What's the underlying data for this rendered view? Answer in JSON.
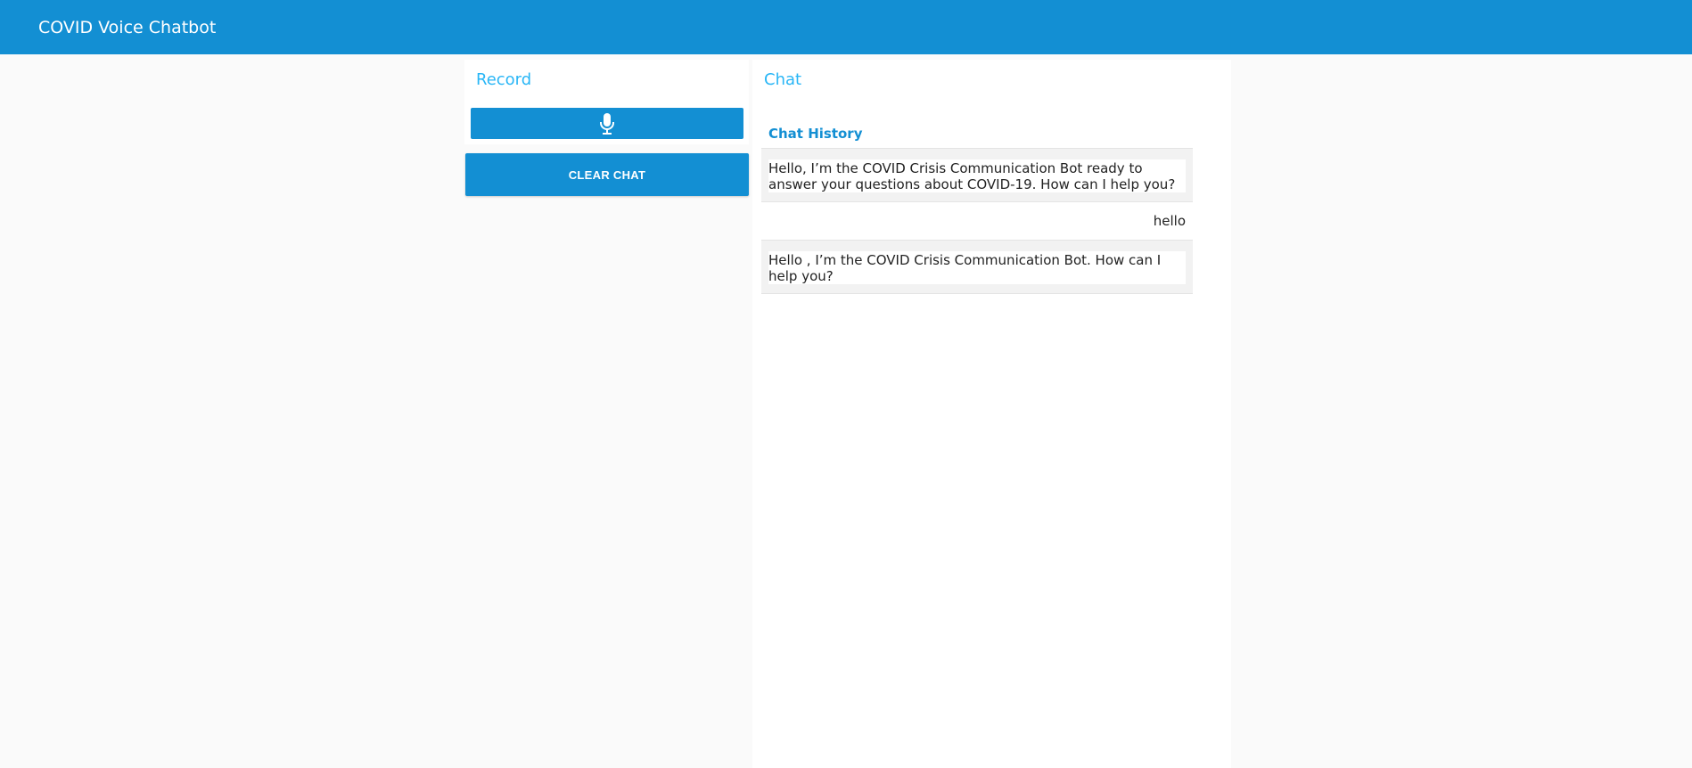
{
  "app": {
    "title": "COVID Voice Chatbot",
    "accent_color": "#138fd3",
    "heading_color": "#29b6f6"
  },
  "record": {
    "heading": "Record",
    "mic_button_icon": "microphone-icon",
    "clear_label": "CLEAR CHAT"
  },
  "chat": {
    "heading": "Chat",
    "history_title": "Chat History",
    "messages": [
      {
        "sender": "bot",
        "text": "Hello, I’m the COVID Crisis Communication Bot ready to answer your questions about COVID-19. How can I help you?"
      },
      {
        "sender": "user",
        "text": "hello"
      },
      {
        "sender": "bot",
        "text": "Hello , I’m the COVID Crisis Communication Bot. How can I help you?"
      }
    ]
  }
}
